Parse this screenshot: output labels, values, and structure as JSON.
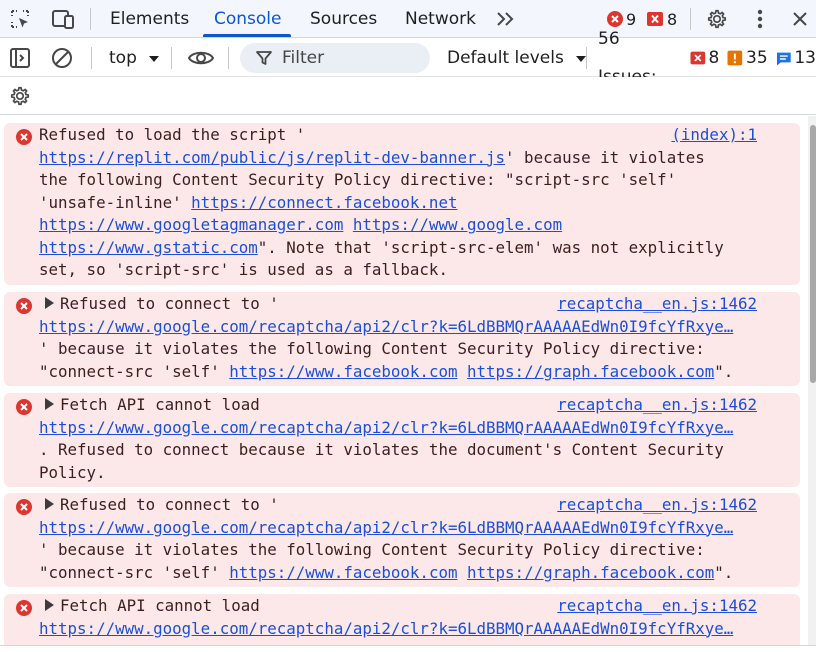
{
  "tabs": [
    "Elements",
    "Console",
    "Sources",
    "Network"
  ],
  "active_tab": "Console",
  "header_badges": {
    "errors": "9",
    "warnings_red": "8"
  },
  "toolbar": {
    "context": "top",
    "filter_placeholder": "Filter",
    "levels": "Default levels",
    "issues_label": "56 Issues:",
    "issues_errors": "8",
    "issues_warnings": "35",
    "issues_info": "13"
  },
  "colors": {
    "accent": "#0b57d0",
    "error": "#dc362e",
    "error_bg": "#fce8e8",
    "warning": "#e37400",
    "info": "#1a73e8",
    "link": "#1a4fd6"
  },
  "messages": [
    {
      "source": "(index):1",
      "line1": "Refused to load the script '",
      "l2_link": "https://replit.com/public/js/replit-dev-banner.js",
      "l2_text": "' because it violates",
      "line3": "the following Content Security Policy directive: \"script-src 'self'",
      "l4_text": "'unsafe-inline' ",
      "l4_link": "https://connect.facebook.net",
      "l5_link1": "https://www.googletagmanager.com",
      "l5_link2": "https://www.google.com",
      "l6_link": "https://www.gstatic.com",
      "l6_text": "\". Note that 'script-src-elem' was not explicitly",
      "line7": "set, so 'script-src' is used as a fallback."
    },
    {
      "source": "recaptcha__en.js:1462",
      "line1": "Refused to connect to '",
      "l2_link": "https://www.google.com/recaptcha/api2/clr?k=6LdBBMQrAAAAAEdWn0I9fcYfRxye…",
      "line3": "' because it violates the following Content Security Policy directive:",
      "l4_text": "\"connect-src 'self' ",
      "l4_link1": "https://www.facebook.com",
      "l4_link2": "https://graph.facebook.com",
      "l4_end": "\"."
    },
    {
      "source": "recaptcha__en.js:1462",
      "line1": "Fetch API cannot load",
      "l2_link": "https://www.google.com/recaptcha/api2/clr?k=6LdBBMQrAAAAAEdWn0I9fcYfRxye…",
      "line3": ". Refused to connect because it violates the document's Content Security",
      "line4": "Policy."
    },
    {
      "source": "recaptcha__en.js:1462",
      "line1": "Refused to connect to '",
      "l2_link": "https://www.google.com/recaptcha/api2/clr?k=6LdBBMQrAAAAAEdWn0I9fcYfRxye…",
      "line3": "' because it violates the following Content Security Policy directive:",
      "l4_text": "\"connect-src 'self' ",
      "l4_link1": "https://www.facebook.com",
      "l4_link2": "https://graph.facebook.com",
      "l4_end": "\"."
    },
    {
      "source": "recaptcha__en.js:1462",
      "line1": "Fetch API cannot load",
      "l2_link": "https://www.google.com/recaptcha/api2/clr?k=6LdBBMQrAAAAAEdWn0I9fcYfRxye…"
    }
  ]
}
